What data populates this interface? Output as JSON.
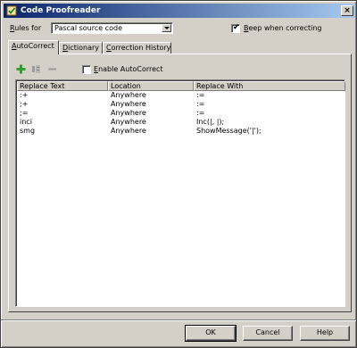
{
  "window": {
    "title": "Code Proofreader",
    "close_glyph": "×",
    "icon": "proofreader-app-icon"
  },
  "rules": {
    "label_accel": "R",
    "label_rest": "ules for",
    "selected": "Pascal source code"
  },
  "beep": {
    "checked": true,
    "label_accel": "B",
    "label_rest": "eep when correcting"
  },
  "tabs": [
    {
      "accel": "A",
      "rest": "utoCorrect",
      "active": true
    },
    {
      "accel": "D",
      "rest": "ictionary",
      "active": false
    },
    {
      "accel": "C",
      "rest": "orrection History",
      "active": false
    }
  ],
  "toolbar": {
    "add_icon": "add-icon",
    "edit_icon": "edit-icon",
    "remove_icon": "remove-icon"
  },
  "enable_autocorrect": {
    "checked": false,
    "label_accel": "E",
    "label_rest": "nable AutoCorrect"
  },
  "list": {
    "columns": [
      "Replace Text",
      "Location",
      "Replace With"
    ],
    "rows": [
      [
        ":+",
        "Anywhere",
        ":="
      ],
      [
        ";+",
        "Anywhere",
        ":="
      ],
      [
        ";=",
        "Anywhere",
        ":="
      ],
      [
        "inci",
        "Anywhere",
        "Inc(|, |);"
      ],
      [
        "smg",
        "Anywhere",
        "ShowMessage('|');"
      ]
    ]
  },
  "buttons": {
    "ok": "OK",
    "cancel": "Cancel",
    "help": "Help"
  },
  "colors": {
    "titlebar": "#0a246a",
    "face": "#d4d0c8",
    "add_icon": "#2e9e2e"
  }
}
